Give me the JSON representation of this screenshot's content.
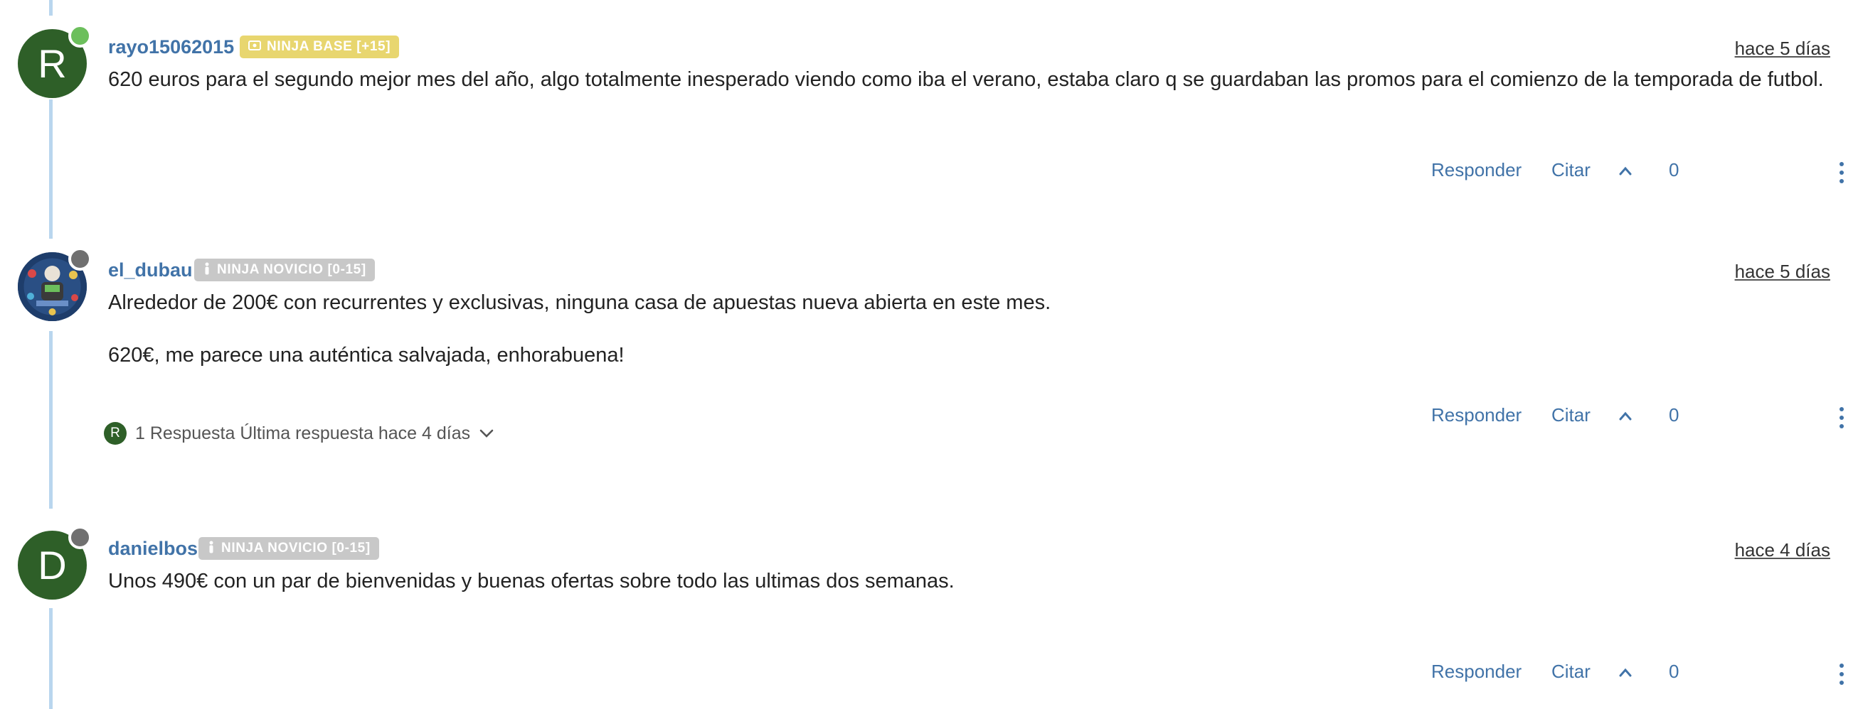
{
  "posts": [
    {
      "avatar_letter": "R",
      "avatar_color": "#2e5f28",
      "presence_color": "#6cbf5c",
      "username": "rayo15062015",
      "badge": {
        "label": "NINJA BASE [+15]",
        "icon": "ticket-icon",
        "bg": "#e8d66f"
      },
      "timestamp": "hace 5 días",
      "paragraphs": [
        "620 euros para el segundo mejor mes del año, algo totalmente inesperado viendo como iba el verano, estaba claro q se guardaban las promos para el comienzo de la temporada de futbol."
      ],
      "actions": {
        "reply": "Responder",
        "quote": "Citar",
        "votes": "0"
      }
    },
    {
      "avatar_letter": "",
      "avatar_color": "#1e3d6b",
      "presence_color": "#707070",
      "username": "el_dubau",
      "badge": {
        "label": "NINJA NOVICIO [0-15]",
        "icon": "person-icon",
        "bg": "#c8c8c8"
      },
      "timestamp": "hace 5 días",
      "paragraphs": [
        "Alrededor de 200€ con recurrentes y exclusivas, ninguna casa de apuestas nueva abierta en este mes.",
        "620€, me parece una auténtica salvajada, enhorabuena!"
      ],
      "replies_summary": {
        "avatar_letter": "R",
        "text": "1 Respuesta Última respuesta hace 4 días"
      },
      "actions": {
        "reply": "Responder",
        "quote": "Citar",
        "votes": "0"
      }
    },
    {
      "avatar_letter": "D",
      "avatar_color": "#2e5f28",
      "presence_color": "#707070",
      "username": "danielbos",
      "badge": {
        "label": "NINJA NOVICIO [0-15]",
        "icon": "person-icon",
        "bg": "#c8c8c8"
      },
      "timestamp": "hace 4 días",
      "paragraphs": [
        "Unos 490€ con un par de bienvenidas y buenas ofertas sobre todo las ultimas dos semanas."
      ],
      "actions": {
        "reply": "Responder",
        "quote": "Citar",
        "votes": "0"
      }
    }
  ]
}
